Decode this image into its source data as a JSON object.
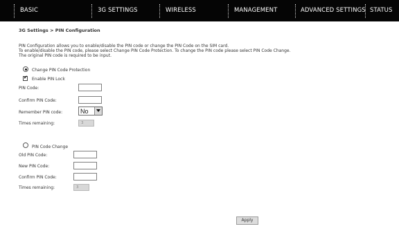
{
  "nav": {
    "items": [
      {
        "label": "BASIC"
      },
      {
        "label": "3G SETTINGS"
      },
      {
        "label": "WIRELESS"
      },
      {
        "label": "MANAGEMENT"
      },
      {
        "label": "ADVANCED SETTINGS"
      },
      {
        "label": "STATUS"
      }
    ]
  },
  "breadcrumb": "3G Settings > PIN Configuration",
  "description": {
    "line1": "PIN Configuration allows you to enable/disable the PIN code or change the PIN Code on the SIM card.",
    "line2": "To enable/disable the PIN code, please select Change PIN Code Protection. To change the PIN code please select PIN Code Change.",
    "line3": "The original PIN code is required to be input."
  },
  "protection": {
    "radio_label": "Change PIN Code Protection",
    "radio_selected": true,
    "enable_lock_label": "Enable PIN Lock",
    "enable_lock_checked": true,
    "pin_code_label": "PIN Code:",
    "pin_code_value": "",
    "confirm_label": "Confirm PIN Code:",
    "confirm_value": "",
    "remember_label": "Remember PIN code:",
    "remember_value": "No",
    "times_label": "Times remaining:",
    "times_value": "3"
  },
  "change": {
    "radio_label": "PIN Code Change",
    "radio_selected": false,
    "old_label": "Old PIN Code:",
    "old_value": "",
    "new_label": "New PIN Code:",
    "new_value": "",
    "confirm_label": "Confirm PIN Code:",
    "confirm_value": "",
    "times_label": "Times remaining:",
    "times_value": "3"
  },
  "apply_label": "Apply",
  "colors": {
    "nav_background": "#050505",
    "nav_text": "#ffffff",
    "readonly_fill": "#d8d8d8",
    "button_fill": "#dcdcdc"
  }
}
